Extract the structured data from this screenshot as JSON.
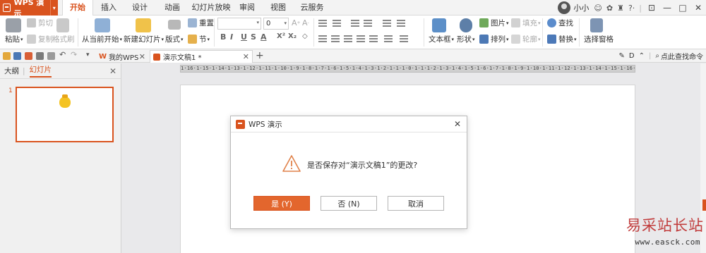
{
  "app": {
    "name": "WPS 演示",
    "accent": "#d9531e"
  },
  "menu": {
    "tabs": [
      "开始",
      "插入",
      "设计",
      "动画",
      "幻灯片放映",
      "审阅",
      "视图",
      "云服务"
    ],
    "active_tab": "开始"
  },
  "user": {
    "name": "小小"
  },
  "ribbon": {
    "paste": "粘贴",
    "cut": "剪切",
    "copy": "复制",
    "format_painter": "格式刷",
    "play_from_current": "从当前开始",
    "new_slide": "新建幻灯片",
    "layout": "版式",
    "section": "节",
    "reset": "重置",
    "font_size": "0",
    "text_box": "文本框",
    "shape": "形状",
    "picture": "图片",
    "fill": "填充",
    "arrange": "排列",
    "outline": "轮廓",
    "find": "查找",
    "replace": "替换",
    "select_pane": "选择窗格"
  },
  "doc_tabs": {
    "my_wps": "我的WPS",
    "current_doc": "演示文稿1 *"
  },
  "quick_right": {
    "search_cmd": "点此查找命令"
  },
  "left_panel": {
    "tab_outline": "大纲",
    "tab_slides": "幻灯片",
    "slide_number": "1"
  },
  "ruler": "1·16·1·15·1·14·1·13·1·12·1·11·1·10·1·9·1·8·1·7·1·6·1·5·1·4·1·3·1·2·1·1·1·0·1·1·1·2·1·3·1·4·1·5·1·6·1·7·1·8·1·9·1·10·1·11·1·12·1·13·1·14·1·15·1·16·1",
  "dialog": {
    "title": "WPS 演示",
    "message": "是否保存对“演示文稿1”的更改?",
    "yes": "是 (Y)",
    "no": "否 (N)",
    "cancel": "取消"
  },
  "watermark": {
    "text": "易采站长站",
    "url": "www.easck.com"
  }
}
